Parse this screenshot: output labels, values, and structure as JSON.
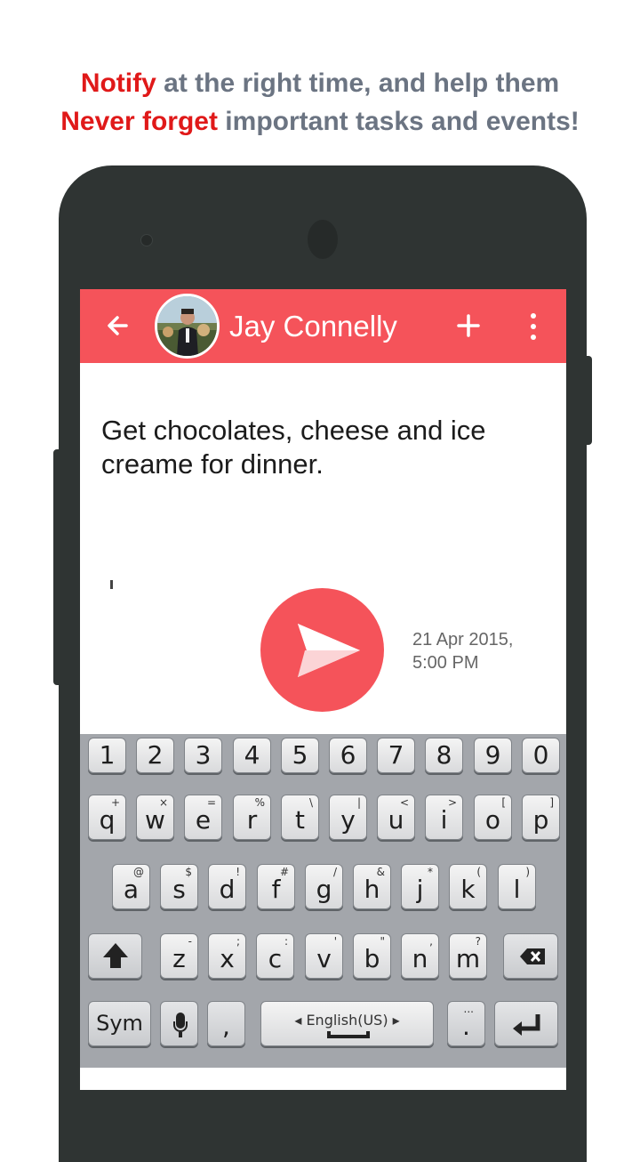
{
  "headline": {
    "line1_accent": "Notify",
    "line1_rest": " at the right time, and help them",
    "line2_accent": "Never forget",
    "line2_rest": " important tasks and events!",
    "accent_color": "#e01919",
    "text_color": "#6b7482"
  },
  "app": {
    "accent_color": "#f5535a",
    "toolbar": {
      "contact_name": "Jay Connelly",
      "back_icon": "arrow-left-icon",
      "add_icon": "plus-icon",
      "menu_icon": "more-vertical-icon"
    },
    "message": {
      "text": "Get chocolates, cheese and ice creame for dinner."
    },
    "reminder": {
      "date": "21 Apr 2015,",
      "time": "5:00 PM"
    },
    "send_icon": "send-icon"
  },
  "keyboard": {
    "numbers": [
      "1",
      "2",
      "3",
      "4",
      "5",
      "6",
      "7",
      "8",
      "9",
      "0"
    ],
    "row1": [
      {
        "k": "q",
        "a": "+"
      },
      {
        "k": "w",
        "a": "×"
      },
      {
        "k": "e",
        "a": "="
      },
      {
        "k": "r",
        "a": "%"
      },
      {
        "k": "t",
        "a": "\\"
      },
      {
        "k": "y",
        "a": "|"
      },
      {
        "k": "u",
        "a": "<"
      },
      {
        "k": "i",
        "a": ">"
      },
      {
        "k": "o",
        "a": "["
      },
      {
        "k": "p",
        "a": "]"
      }
    ],
    "row2": [
      {
        "k": "a",
        "a": "@"
      },
      {
        "k": "s",
        "a": "$"
      },
      {
        "k": "d",
        "a": "!"
      },
      {
        "k": "f",
        "a": "#"
      },
      {
        "k": "g",
        "a": "/"
      },
      {
        "k": "h",
        "a": "&"
      },
      {
        "k": "j",
        "a": "*"
      },
      {
        "k": "k",
        "a": "("
      },
      {
        "k": "l",
        "a": ")"
      }
    ],
    "row3": [
      {
        "k": "z",
        "a": "-"
      },
      {
        "k": "x",
        "a": ";"
      },
      {
        "k": "c",
        "a": ":"
      },
      {
        "k": "v",
        "a": "'"
      },
      {
        "k": "b",
        "a": "\""
      },
      {
        "k": "n",
        "a": ","
      },
      {
        "k": "m",
        "a": "?"
      }
    ],
    "shift_icon": "shift-arrow-icon",
    "backspace_icon": "backspace-icon",
    "sym_label": "Sym",
    "mic_icon": "microphone-icon",
    "comma_label": ",",
    "space_label": "English(US)",
    "period_label": ".",
    "period_alt": "...",
    "enter_icon": "enter-return-icon"
  }
}
